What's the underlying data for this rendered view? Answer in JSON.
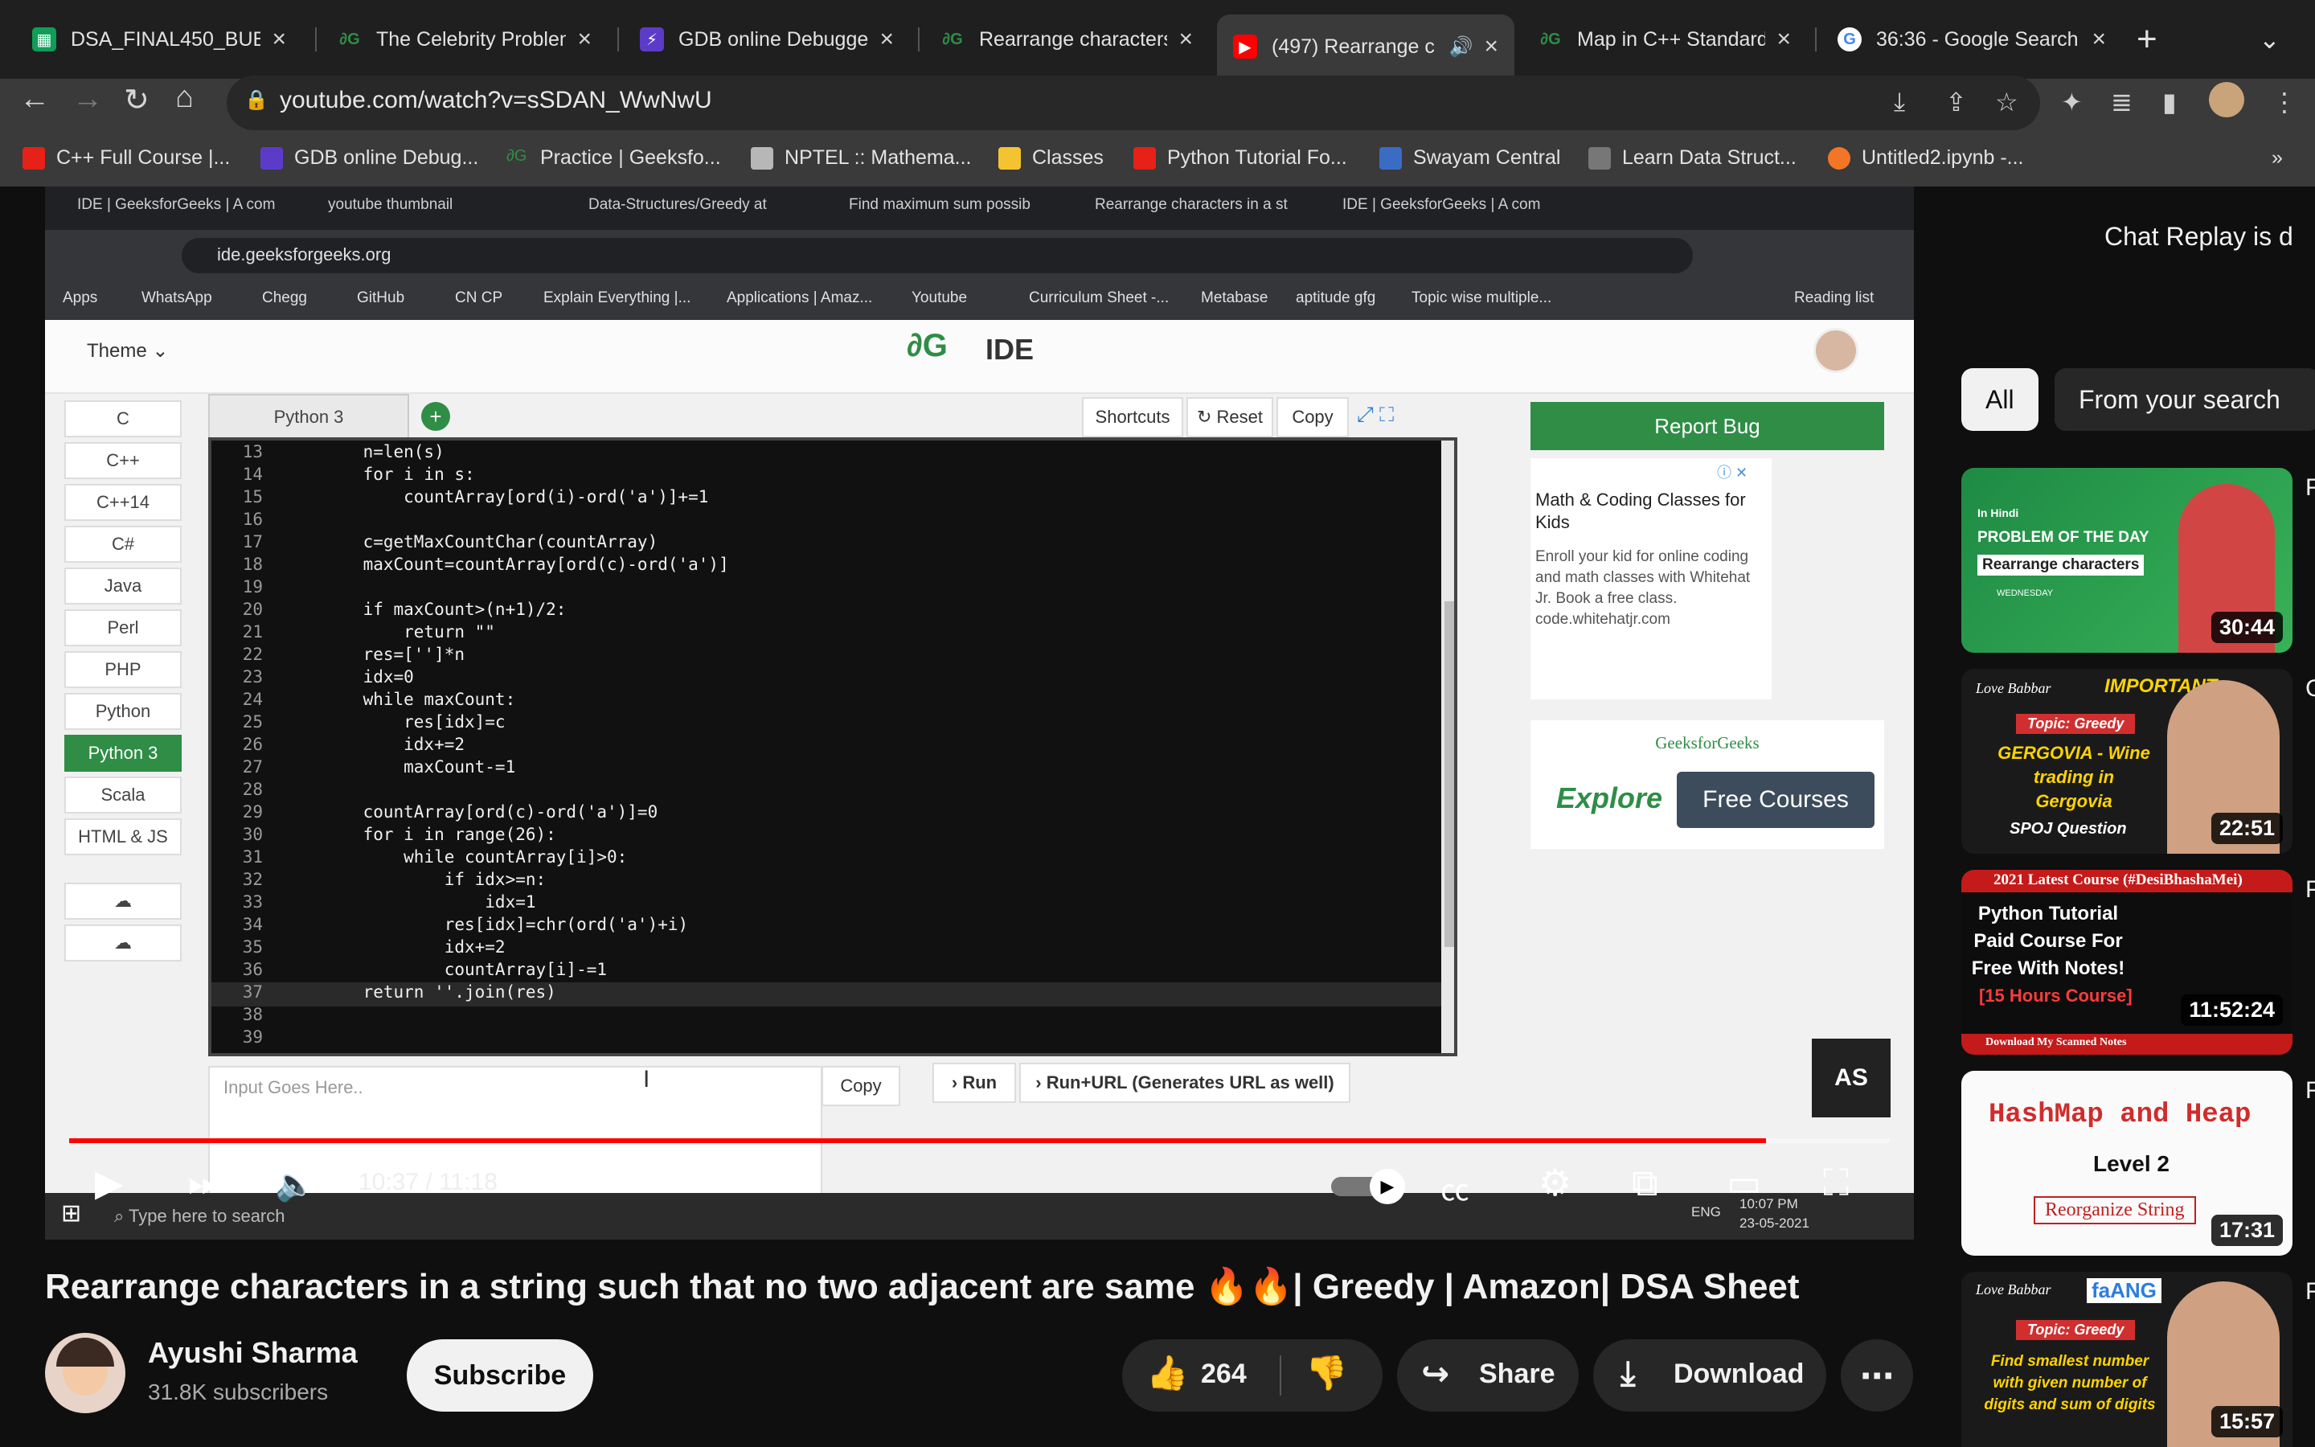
{
  "browser": {
    "tabs": [
      {
        "title": "DSA_FINAL450_BUBB",
        "icon": "sheets-icon"
      },
      {
        "title": "The Celebrity Problem",
        "icon": "gfg-icon"
      },
      {
        "title": "GDB online Debugger",
        "icon": "gdb-icon"
      },
      {
        "title": "Rearrange characters",
        "icon": "gfg-icon"
      },
      {
        "title": "(497) Rearrange c",
        "icon": "youtube-icon"
      },
      {
        "title": "Map in C++ Standard",
        "icon": "gfg-icon"
      },
      {
        "title": "36:36 - Google Search",
        "icon": "google-icon"
      }
    ],
    "url": "youtube.com/watch?v=sSDAN_WwNwU",
    "bookmarks": [
      "C++ Full Course |...",
      "GDB online Debug...",
      "Practice | Geeksfo...",
      "NPTEL :: Mathema...",
      "Classes",
      "Python Tutorial Fo...",
      "Swayam Central",
      "Learn Data Struct...",
      "Untitled2.ipynb -..."
    ],
    "more": "»"
  },
  "video": {
    "inner_tabs": [
      "IDE | GeeksforGeeks | A com",
      "youtube thumbnail",
      "Data-Structures/Greedy at",
      "Find maximum sum possib",
      "Rearrange characters in a st",
      "IDE | GeeksforGeeks | A com"
    ],
    "inner_url": "ide.geeksforgeeks.org",
    "inner_bookmarks": [
      "Apps",
      "WhatsApp",
      "Chegg",
      "GitHub",
      "CN CP",
      "Explain Everything |...",
      "Applications | Amaz...",
      "Youtube",
      "Curriculum Sheet -...",
      "Metabase",
      "aptitude gfg",
      "Topic wise multiple...",
      "Reading list"
    ],
    "ide": {
      "theme": "Theme",
      "title": "IDE",
      "languages": [
        "C",
        "C++",
        "C++14",
        "C#",
        "Java",
        "Perl",
        "PHP",
        "Python",
        "Python 3",
        "Scala",
        "HTML & JS"
      ],
      "active_language": "Python 3",
      "tab": "Python 3",
      "buttons": {
        "shortcuts": "Shortcuts",
        "reset": "Reset",
        "copy": "Copy"
      },
      "report_bug": "Report Bug",
      "code_lines": [
        {
          "n": "13",
          "t": "    n=len(s)"
        },
        {
          "n": "14",
          "t": "    for i in s:"
        },
        {
          "n": "15",
          "t": "        countArray[ord(i)-ord('a')]+=1"
        },
        {
          "n": "16",
          "t": ""
        },
        {
          "n": "17",
          "t": "    c=getMaxCountChar(countArray)"
        },
        {
          "n": "18",
          "t": "    maxCount=countArray[ord(c)-ord('a')]"
        },
        {
          "n": "19",
          "t": ""
        },
        {
          "n": "20",
          "t": "    if maxCount>(n+1)/2:"
        },
        {
          "n": "21",
          "t": "        return \"\""
        },
        {
          "n": "22",
          "t": "    res=['']*n"
        },
        {
          "n": "23",
          "t": "    idx=0"
        },
        {
          "n": "24",
          "t": "    while maxCount:"
        },
        {
          "n": "25",
          "t": "        res[idx]=c"
        },
        {
          "n": "26",
          "t": "        idx+=2"
        },
        {
          "n": "27",
          "t": "        maxCount-=1"
        },
        {
          "n": "28",
          "t": ""
        },
        {
          "n": "29",
          "t": "    countArray[ord(c)-ord('a')]=0"
        },
        {
          "n": "30",
          "t": "    for i in range(26):"
        },
        {
          "n": "31",
          "t": "        while countArray[i]>0:"
        },
        {
          "n": "32",
          "t": "            if idx>=n:"
        },
        {
          "n": "33",
          "t": "                idx=1"
        },
        {
          "n": "34",
          "t": "            res[idx]=chr(ord('a')+i)"
        },
        {
          "n": "35",
          "t": "            idx+=2"
        },
        {
          "n": "36",
          "t": "            countArray[i]-=1"
        },
        {
          "n": "37",
          "t": "    return ''.join(res)"
        },
        {
          "n": "38",
          "t": ""
        },
        {
          "n": "39",
          "t": ""
        }
      ],
      "ad1_title": "Math & Coding Classes for Kids",
      "ad1_body": "Enroll your kid for online coding and math classes with Whitehat Jr. Book a free class. code.whitehatjr.com",
      "ad2_brand": "GeeksforGeeks",
      "ad2_explore": "Explore",
      "ad2_button": "Free Courses",
      "input_placeholder": "Input Goes Here..",
      "input_copy": "Copy",
      "run": "Run",
      "run_url": "Run+URL (Generates URL as well)",
      "badge": "AS"
    },
    "taskbar_search": "Type here to search",
    "taskbar_clock": "10:07 PM",
    "taskbar_date": "23-05-2021",
    "taskbar_lang": "ENG",
    "player": {
      "time": "10:37 / 11:18",
      "progress": 0.932
    }
  },
  "meta": {
    "title": "Rearrange characters in a string such that no two adjacent are same 🔥🔥| Greedy | Amazon| DSA Sheet",
    "channel": "Ayushi Sharma",
    "subscribers": "31.8K subscribers",
    "subscribe": "Subscribe",
    "likes": "264",
    "share": "Share",
    "download": "Download"
  },
  "sidebar": {
    "chat_replay": "Chat Replay is d",
    "chips": [
      "All",
      "From your search"
    ],
    "videos": [
      {
        "duration": "30:44",
        "line1": "In Hindi",
        "line2": "PROBLEM OF THE DAY",
        "line3": "Rearrange characters",
        "line4": "WEDNESDAY"
      },
      {
        "duration": "22:51",
        "line1": "Love Babbar",
        "line2": "IMPORTANT",
        "line3": "Topic: Greedy",
        "line4": "GERGOVIA - Wine trading in Gergovia",
        "line5": "SPOJ Question"
      },
      {
        "duration": "11:52:24",
        "line1": "2021 Latest Course (#DesiBhashaMei)",
        "line2": "Python Tutorial Paid Course For Free With Notes!",
        "line3": "[15 Hours Course]",
        "line4": "Download My Scanned Notes"
      },
      {
        "duration": "17:31",
        "line1": "HashMap and Heap",
        "line2": "Level 2",
        "line3": "Reorganize String"
      },
      {
        "duration": "15:57",
        "line1": "Love Babbar",
        "line2": "faANG",
        "line3": "Topic: Greedy",
        "line4": "Find smallest number with given number of digits and sum of digits"
      }
    ]
  }
}
